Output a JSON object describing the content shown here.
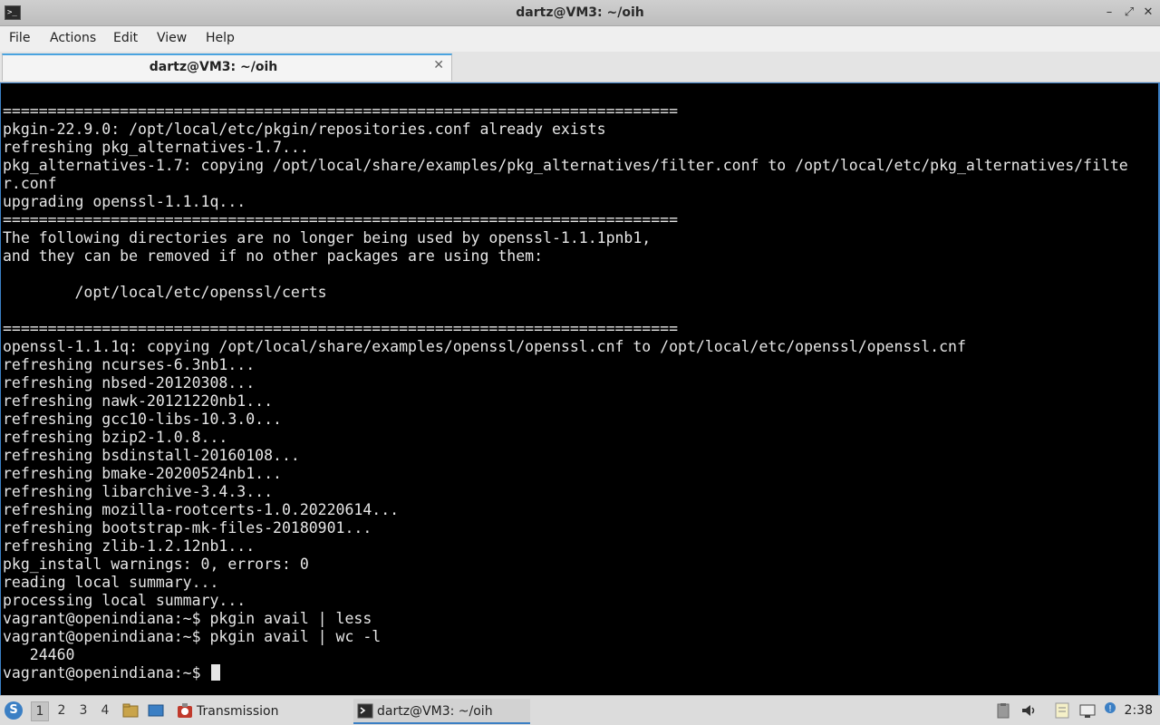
{
  "window": {
    "title": "dartz@VM3: ~/oih",
    "controls": {
      "minimize": "–",
      "maximize": "⤢",
      "close": "✕"
    }
  },
  "menubar": {
    "items": [
      "File",
      "Actions",
      "Edit",
      "View",
      "Help"
    ]
  },
  "tabs": [
    {
      "label": "dartz@VM3: ~/oih",
      "close": "✕",
      "active": true
    }
  ],
  "terminal": {
    "lines": [
      "===========================================================================",
      "pkgin-22.9.0: /opt/local/etc/pkgin/repositories.conf already exists",
      "refreshing pkg_alternatives-1.7...",
      "pkg_alternatives-1.7: copying /opt/local/share/examples/pkg_alternatives/filter.conf to /opt/local/etc/pkg_alternatives/filte",
      "r.conf",
      "upgrading openssl-1.1.1q...",
      "===========================================================================",
      "The following directories are no longer being used by openssl-1.1.1pnb1,",
      "and they can be removed if no other packages are using them:",
      "",
      "        /opt/local/etc/openssl/certs",
      "",
      "===========================================================================",
      "openssl-1.1.1q: copying /opt/local/share/examples/openssl/openssl.cnf to /opt/local/etc/openssl/openssl.cnf",
      "refreshing ncurses-6.3nb1...",
      "refreshing nbsed-20120308...",
      "refreshing nawk-20121220nb1...",
      "refreshing gcc10-libs-10.3.0...",
      "refreshing bzip2-1.0.8...",
      "refreshing bsdinstall-20160108...",
      "refreshing bmake-20200524nb1...",
      "refreshing libarchive-3.4.3...",
      "refreshing mozilla-rootcerts-1.0.20220614...",
      "refreshing bootstrap-mk-files-20180901...",
      "refreshing zlib-1.2.12nb1...",
      "pkg_install warnings: 0, errors: 0",
      "reading local summary...",
      "processing local summary...",
      "vagrant@openindiana:~$ pkgin avail | less",
      "vagrant@openindiana:~$ pkgin avail | wc -l",
      "   24460",
      "vagrant@openindiana:~$ "
    ]
  },
  "taskbar": {
    "workspaces": [
      "1",
      "2",
      "3",
      "4"
    ],
    "active_workspace": "1",
    "tasks": [
      {
        "label": "Transmission",
        "icon": "transmission-icon"
      },
      {
        "label": "dartz@VM3: ~/oih",
        "icon": "terminal-icon",
        "active": true
      }
    ],
    "clock": "2:38",
    "tray_icons": [
      "clipboard-icon",
      "volume-icon",
      "notes-icon",
      "network-icon",
      "update-notification-icon"
    ]
  }
}
